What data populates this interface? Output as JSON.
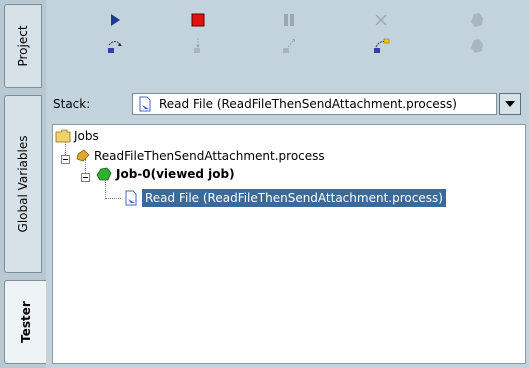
{
  "tabs": [
    {
      "label": "Project",
      "selected": false
    },
    {
      "label": "Global Variables",
      "selected": false
    },
    {
      "label": "Tester",
      "selected": true
    }
  ],
  "toolbar": {
    "row1": [
      "play-icon",
      "stop-icon",
      "pause-icon",
      "close-icon",
      "breakpoint-icon"
    ],
    "row2": [
      "step-over-icon",
      "step-into-icon",
      "step-out-icon",
      "step-to-icon",
      "breakpoint-clear-icon"
    ]
  },
  "stack": {
    "label": "Stack:",
    "selected": "Read File (ReadFileThenSendAttachment.process)"
  },
  "tree": {
    "root": "Jobs",
    "process": "ReadFileThenSendAttachment.process",
    "job": "Job-0(viewed job)",
    "activity": "Read File (ReadFileThenSendAttachment.process)"
  },
  "colors": {
    "selection": "#3c6a98",
    "panel": "#c3d3de"
  }
}
